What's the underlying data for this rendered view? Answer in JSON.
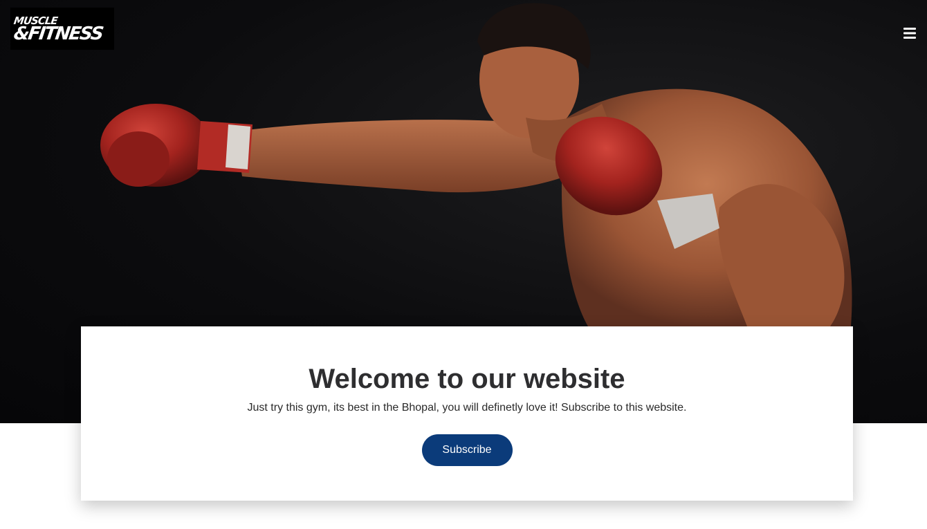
{
  "brand": {
    "logo_line1": "MUSCLE",
    "logo_line2": "&FITNESS"
  },
  "header": {
    "menu_icon": "hamburger-menu-icon"
  },
  "hero": {
    "image": "boxer-punching-photo"
  },
  "welcome": {
    "title": "Welcome to our website",
    "text": "Just try this gym, its best in the Bhopal, you will definetly love it! Subscribe to this website.",
    "subscribe_label": "Subscribe"
  },
  "colors": {
    "button": "#0b3b7a",
    "hero_bg": "#0c0c0e",
    "glove": "#a8231f",
    "skin": "#b06a45"
  }
}
